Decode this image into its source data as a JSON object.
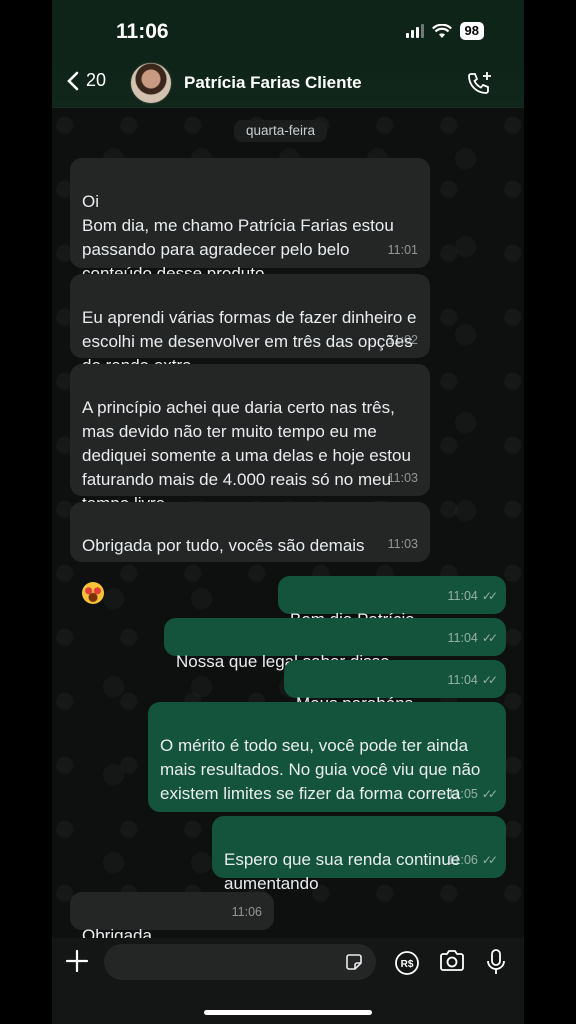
{
  "status_bar": {
    "time": "11:06",
    "battery": "98"
  },
  "header": {
    "back_count": "20",
    "contact_name": "Patrícia Farias Cliente"
  },
  "day_label": "quarta-feira",
  "messages": [
    {
      "dir": "in",
      "text": "Oi\nBom dia, me chamo Patrícia Farias estou passando para agradecer pelo belo conteúdo desse produto",
      "time": "11:01"
    },
    {
      "dir": "in",
      "text": "Eu aprendi várias formas de fazer dinheiro e escolhi me desenvolver em três das opções de renda extra",
      "time": "11:02"
    },
    {
      "dir": "in",
      "text": "A princípio achei que daria certo nas três, mas devido não ter muito tempo eu me dediquei somente a uma delas e hoje estou faturando mais de 4.000 reais só no meu tempo livre",
      "time": "11:03"
    },
    {
      "dir": "in",
      "text": "Obrigada por tudo, vocês são demais",
      "time": "11:03"
    },
    {
      "dir": "out",
      "text": "Bom dia Patrícia",
      "time": "11:04"
    },
    {
      "dir": "out",
      "text": "Nossa que legal saber disso",
      "time": "11:04"
    },
    {
      "dir": "out",
      "text": "Meus parabéns",
      "time": "11:04"
    },
    {
      "dir": "out",
      "text": "O mérito é todo seu, você pode ter ainda mais resultados. No guia você viu que não existem limites se fizer da forma correta",
      "time": "11:05"
    },
    {
      "dir": "out",
      "text": "Espero que sua renda continue aumentando",
      "time": "11:06"
    },
    {
      "dir": "in",
      "text": "Obrigada",
      "time": "11:06"
    }
  ],
  "icons": {
    "back": "chevron-left-icon",
    "call": "phone-add-icon",
    "plus": "plus-icon",
    "sticker": "sticker-icon",
    "pay": "payment-icon",
    "camera": "camera-icon",
    "mic": "microphone-icon"
  },
  "colors": {
    "incoming_bubble": "#242626",
    "outgoing_bubble": "#14533c",
    "header": "#0e2418"
  }
}
